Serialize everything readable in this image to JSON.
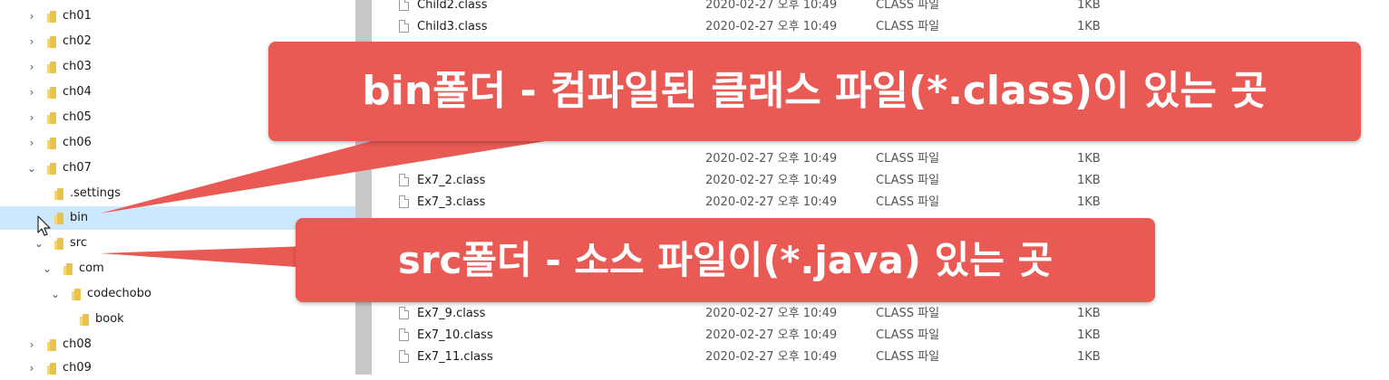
{
  "tree": {
    "items": [
      {
        "label": "ch01",
        "expanded": false
      },
      {
        "label": "ch02",
        "expanded": false
      },
      {
        "label": "ch03",
        "expanded": false
      },
      {
        "label": "ch04",
        "expanded": false
      },
      {
        "label": "ch05",
        "expanded": false
      },
      {
        "label": "ch06",
        "expanded": false
      },
      {
        "label": "ch07",
        "expanded": true
      },
      {
        "label": ".settings",
        "expanded": false
      },
      {
        "label": "bin",
        "expanded": false,
        "selected": true
      },
      {
        "label": "src",
        "expanded": true
      },
      {
        "label": "com",
        "expanded": true
      },
      {
        "label": "codechobo",
        "expanded": true
      },
      {
        "label": "book",
        "expanded": false
      },
      {
        "label": "ch08",
        "expanded": false
      },
      {
        "label": "ch09",
        "expanded": false
      }
    ]
  },
  "files": {
    "rows": [
      {
        "name": "Child2.class",
        "date": "2020-02-27 오후 10:49",
        "type": "CLASS 파일",
        "size": "1KB"
      },
      {
        "name": "Child3.class",
        "date": "2020-02-27 오후 10:49",
        "type": "CLASS 파일",
        "size": "1KB"
      },
      {
        "name": "",
        "date": "2020-02-27 오후 10:49",
        "type": "CLASS 파일",
        "size": "1KB"
      },
      {
        "name": "Ex7_2.class",
        "date": "2020-02-27 오후 10:49",
        "type": "CLASS 파일",
        "size": "1KB"
      },
      {
        "name": "Ex7_3.class",
        "date": "2020-02-27 오후 10:49",
        "type": "CLASS 파일",
        "size": "1KB"
      },
      {
        "name": "Ex7_9.class",
        "date": "2020-02-27 오후 10:49",
        "type": "CLASS 파일",
        "size": "1KB"
      },
      {
        "name": "Ex7_10.class",
        "date": "2020-02-27 오후 10:49",
        "type": "CLASS 파일",
        "size": "1KB"
      },
      {
        "name": "Ex7_11.class",
        "date": "2020-02-27 오후 10:49",
        "type": "CLASS 파일",
        "size": "1KB"
      }
    ]
  },
  "callouts": {
    "bin": "bin폴더 - 컴파일된 클래스 파일(*.class)이 있는 곳",
    "src": "src폴더 - 소스 파일이(*.java) 있는 곳"
  },
  "colors": {
    "callout": "#e85a53",
    "selection": "#cce8ff",
    "folder": "#e8c24a"
  },
  "icons": {
    "folder": "folder-icon",
    "file": "file-icon",
    "expand": "chevron-right-icon",
    "collapse": "chevron-down-icon",
    "cursor": "mouse-cursor-icon"
  }
}
